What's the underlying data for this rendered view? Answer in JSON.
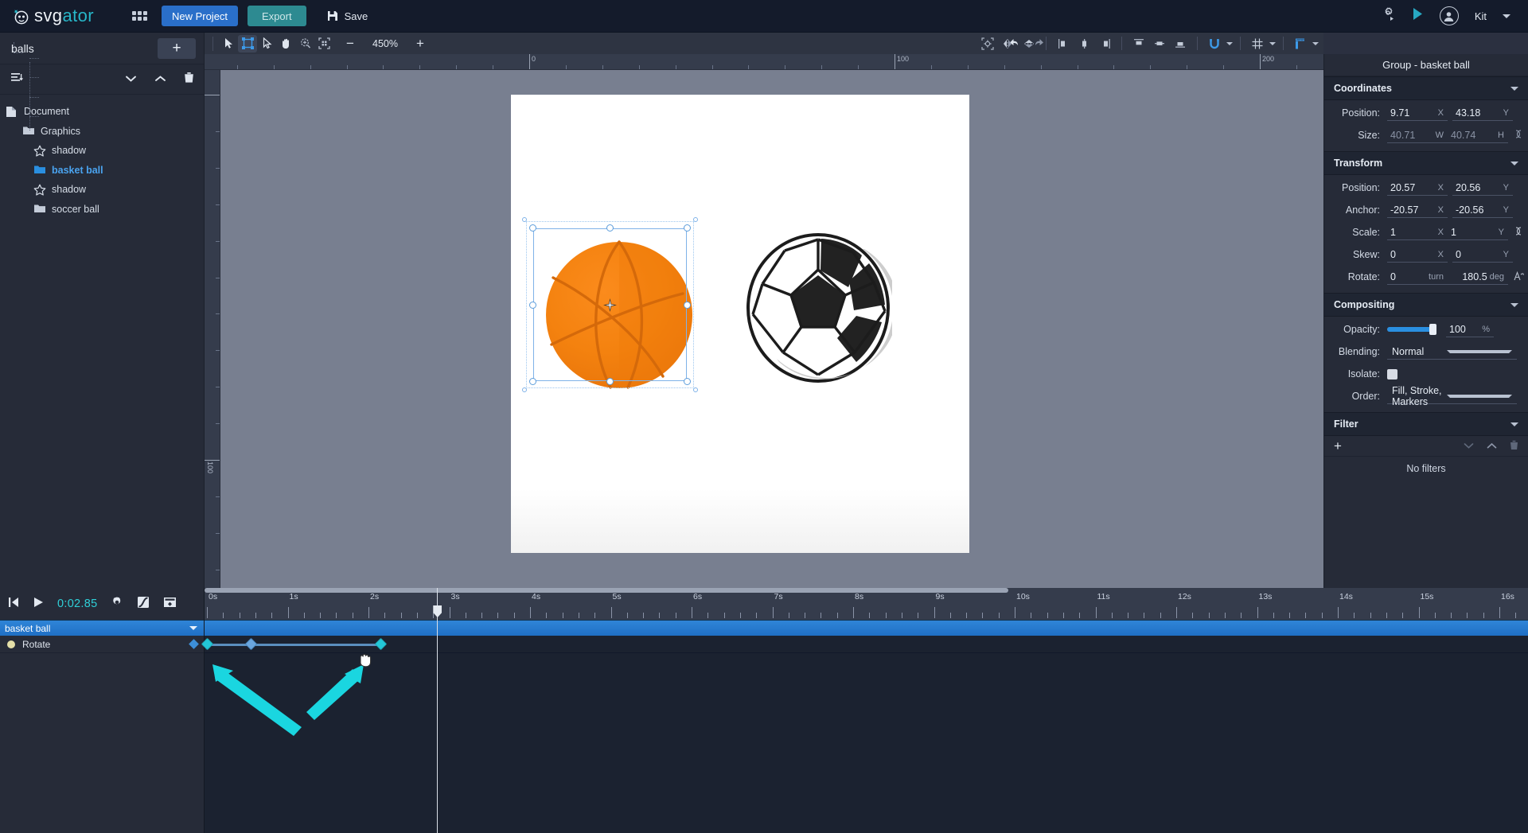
{
  "app": {
    "brand_white": "svg",
    "brand_accent": "ator",
    "accent_color": "#27b6c8",
    "primary_color": "#2a6fc9"
  },
  "topbar": {
    "grid_icon": "apps-grid-icon",
    "new_project_label": "New Project",
    "export_label": "Export",
    "save_label": "Save",
    "save_icon": "floppy-disk-icon",
    "settings_icon": "gear-run-icon",
    "preview_icon": "play-icon",
    "avatar_icon": "user-avatar-icon",
    "user_name": "Kit",
    "user_caret": "chevron-down-icon"
  },
  "left_panel": {
    "project_title": "balls",
    "add_label": "+",
    "tools": {
      "sort_icon": "sort-list-icon",
      "move_down_icon": "chevron-down-icon",
      "move_up_icon": "chevron-up-icon",
      "delete_icon": "trash-icon"
    },
    "tree": [
      {
        "label": "Document",
        "icon": "document-icon",
        "level": 0,
        "selected": false
      },
      {
        "label": "Graphics",
        "icon": "folder-icon",
        "level": 1,
        "selected": false
      },
      {
        "label": "shadow",
        "icon": "star-outline-icon",
        "level": 2,
        "selected": false
      },
      {
        "label": "basket ball",
        "icon": "folder-filled-icon",
        "level": 2,
        "selected": true
      },
      {
        "label": "shadow",
        "icon": "star-outline-icon",
        "level": 2,
        "selected": false
      },
      {
        "label": "soccer ball",
        "icon": "folder-icon",
        "level": 2,
        "selected": false
      }
    ]
  },
  "canvas_toolbar": {
    "tools": [
      {
        "name": "select-tool",
        "icon": "cursor-arrow-icon",
        "active": false
      },
      {
        "name": "transform-tool",
        "icon": "bounding-box-icon",
        "active": true
      },
      {
        "name": "node-tool",
        "icon": "node-arrow-icon",
        "active": false
      },
      {
        "name": "pan-tool",
        "icon": "hand-icon",
        "active": false
      },
      {
        "name": "zoom-tool",
        "icon": "magnifier-plus-icon",
        "active": false
      },
      {
        "name": "fit-tool",
        "icon": "fit-frame-icon",
        "active": false
      }
    ],
    "zoom_out": "−",
    "zoom_value": "450%",
    "zoom_in": "+",
    "undo_icon": "undo-arrow-icon",
    "redo_icon": "redo-arrow-icon",
    "right_tools": [
      "anchor-center-icon",
      "flip-horizontal-icon",
      "flip-vertical-icon",
      "align-left-icon",
      "align-center-horizontal-icon",
      "align-right-icon",
      "align-top-icon",
      "align-middle-vertical-icon",
      "align-bottom-icon",
      "snap-magnet-icon",
      "grid-icon",
      "rulers-icon"
    ]
  },
  "canvas": {
    "ruler_labels": [
      "0",
      "100",
      "200"
    ],
    "ruler_v_label": "100",
    "basket_ball_name": "basket ball",
    "soccer_ball_name": "soccer ball",
    "anchor_icon": "anchor-point-icon"
  },
  "right_panel": {
    "title": "Group - basket ball",
    "sections": {
      "coordinates": {
        "heading": "Coordinates",
        "position_label": "Position:",
        "position_x": "9.71",
        "position_x_unit": "X",
        "position_y": "43.18",
        "position_y_unit": "Y",
        "size_label": "Size:",
        "size_w": "40.71",
        "size_w_unit": "W",
        "size_h": "40.74",
        "size_h_unit": "H",
        "link_icon": "link-ratio-icon"
      },
      "transform": {
        "heading": "Transform",
        "position_label": "Position:",
        "position_x": "20.57",
        "position_y": "20.56",
        "anchor_label": "Anchor:",
        "anchor_x": "-20.57",
        "anchor_y": "-20.56",
        "scale_label": "Scale:",
        "scale_x": "1",
        "scale_y": "1",
        "skew_label": "Skew:",
        "skew_x": "0",
        "skew_y": "0",
        "rotate_label": "Rotate:",
        "rotate_turn": "0",
        "rotate_turn_unit": "turn",
        "rotate_deg": "180.5",
        "rotate_deg_unit": "deg",
        "unit_x": "X",
        "unit_y": "Y",
        "link_icon": "link-ratio-icon",
        "rotate_icon": "rotate-direction-icon"
      },
      "compositing": {
        "heading": "Compositing",
        "opacity_label": "Opacity:",
        "opacity_value": "100",
        "opacity_unit": "%",
        "opacity_percent": 100,
        "blending_label": "Blending:",
        "blending_value": "Normal",
        "isolate_label": "Isolate:",
        "order_label": "Order:",
        "order_value": "Fill, Stroke, Markers"
      },
      "filter": {
        "heading": "Filter",
        "add_label": "+",
        "down_icon": "chevron-down-icon",
        "up_icon": "chevron-up-icon",
        "delete_icon": "trash-icon",
        "empty_text": "No filters"
      }
    }
  },
  "timeline": {
    "controls": {
      "to_start_icon": "skip-to-start-icon",
      "play_icon": "play-icon",
      "current_time": "0:02.85",
      "settings_icon": "gear-icon",
      "easing_icon": "easing-curve-icon",
      "keyframe_view_icon": "keyframe-panel-icon"
    },
    "layer_name": "basket ball",
    "layer_caret": "chevron-down-icon",
    "property_name": "Rotate",
    "property_bulb": "visibility-dot-icon",
    "property_keyframe_icon": "add-keyframe-icon",
    "ruler_labels": [
      "0s",
      "1s",
      "2s",
      "3s",
      "4s",
      "5s",
      "6s",
      "7s",
      "8s",
      "9s",
      "10s",
      "11s",
      "12s",
      "13s",
      "14s",
      "15s",
      "16s"
    ],
    "playhead_time": "2.85",
    "keyframes": [
      {
        "time_s": 0.0,
        "color": "cyan"
      },
      {
        "time_s": 0.55,
        "color": "blue"
      },
      {
        "time_s": 2.15,
        "color": "cyan"
      }
    ]
  }
}
